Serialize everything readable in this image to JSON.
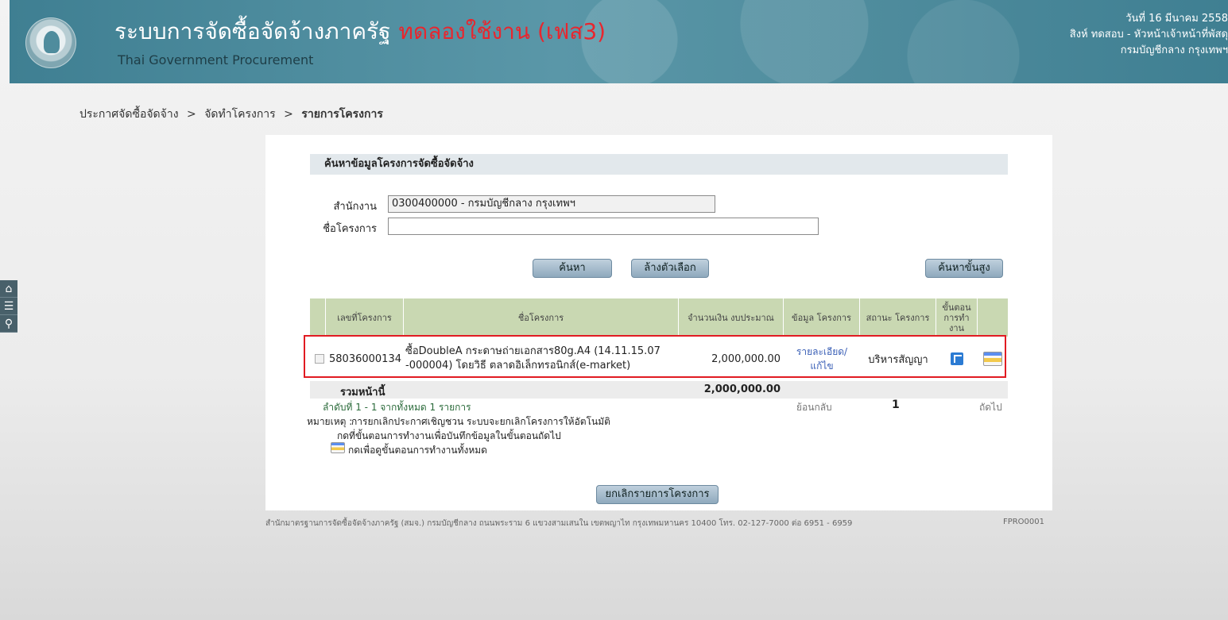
{
  "header": {
    "title": "ระบบการจัดซื้อจัดจ้างภาครัฐ",
    "trial_label": "ทดลองใช้งาน (เฟส3)",
    "subtitle": "Thai Government Procurement",
    "date": "วันที่ 16 มีนาคม 2558",
    "user": "สิงห์ ทดสอบ - หัวหน้าเจ้าหน้าที่พัสดุ",
    "organization": "กรมบัญชีกลาง กรุงเทพฯ"
  },
  "breadcrumb": {
    "items": [
      "ประกาศจัดซื้อจัดจ้าง",
      "จัดทำโครงการ",
      "รายการโครงการ"
    ],
    "separator": ">"
  },
  "side_tools": [
    "home-icon",
    "menu-icon",
    "search-icon"
  ],
  "search": {
    "heading": "ค้นหาข้อมูลโครงการจัดซื้อจัดจ้าง",
    "org_label": "สำนักงาน",
    "org_value": "0300400000 - กรมบัญชีกลาง กรุงเทพฯ",
    "project_label": "ชื่อโครงการ",
    "project_value": "",
    "btn_search": "ค้นหา",
    "btn_clear": "ล้างตัวเลือก",
    "btn_advanced": "ค้นหาขั้นสูง"
  },
  "table": {
    "columns": [
      "เลขที่โครงการ",
      "ชื่อโครงการ",
      "จำนวนเงิน งบประมาณ",
      "ข้อมูล โครงการ",
      "สถานะ โครงการ",
      "ขั้นตอน การทำ งาน"
    ],
    "rows": [
      {
        "project_no": "58036000134",
        "name_line1": "ซื้อDoubleA กระดาษถ่ายเอกสาร80g.A4 (14.11.15.07",
        "name_line2": "-000004) โดยวิธี ตลาดอิเล็กทรอนิกส์(e-market)",
        "amount": "2,000,000.00",
        "info_link_1": "รายละเอียด/",
        "info_link_2": "แก้ไข",
        "status": "บริหารสัญญา"
      }
    ],
    "total_label": "รวมหน้านี้",
    "total_amount": "2,000,000.00"
  },
  "pager": {
    "summary": "ลำดับที่ 1 - 1 จากทั้งหมด 1 รายการ",
    "back": "ย้อนกลับ",
    "current_page": "1",
    "next": "ถัดไป"
  },
  "notes": {
    "label": "หมายเหตุ :",
    "line1": "การยกเลิกประกาศเชิญชวน ระบบจะยกเลิกโครงการให้อัตโนมัติ",
    "line2": "กดที่ขั้นตอนการทำงานเพื่อบันทึกข้อมูลในขั้นตอนถัดไป",
    "line3": "กดเพื่อดูขั้นตอนการทำงานทั้งหมด"
  },
  "cancel_button": "ยกเลิกรายการโครงการ",
  "footer": {
    "address": "สำนักมาตรฐานการจัดซื้อจัดจ้างภาครัฐ (สมจ.) กรมบัญชีกลาง ถนนพระราม 6 แขวงสามเสนใน เขตพญาไท กรุงเทพมหานคร 10400 โทร. 02-127-7000 ต่อ 6951 - 6959",
    "code": "FPRO0001"
  },
  "colors": {
    "header_bg": "#4f8c9d",
    "trial_red": "#e8262e",
    "table_header": "#c9d8b2",
    "highlight_border": "#e11b22",
    "link": "#3a5fb6"
  }
}
